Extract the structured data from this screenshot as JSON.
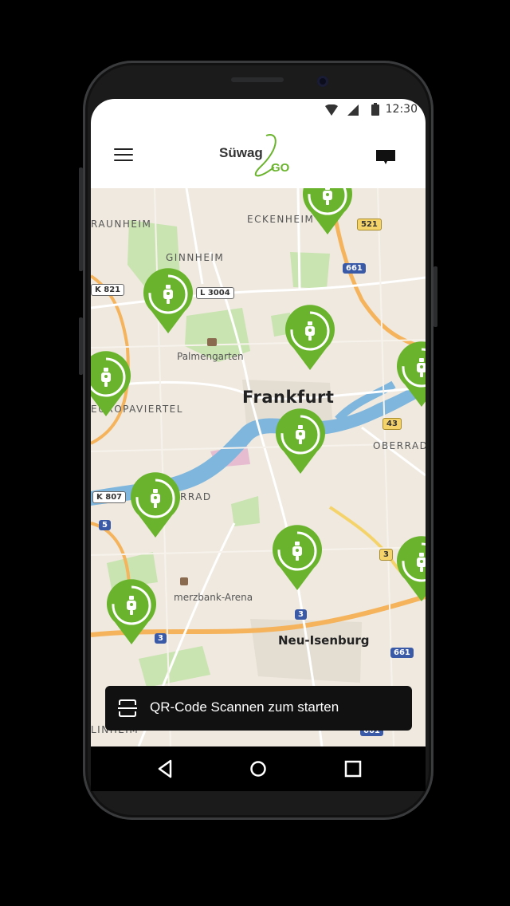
{
  "status": {
    "time": "12:30"
  },
  "header": {
    "logo_text": "Süwag",
    "logo_suffix": "GO",
    "menu_icon": "hamburger-menu-icon",
    "message_icon": "message-icon"
  },
  "map": {
    "labels": {
      "raunheim": "RAUNHEIM",
      "eckenheim": "ECKENHEIM",
      "ginnheim": "GINNHEIM",
      "palmengarten": "Palmengarten",
      "frankfurt": "Frankfurt",
      "europaviertel": "EUROPAVIERTEL",
      "oberrad": "OBERRAD",
      "rrad": "RRAD",
      "arena": "merzbank-Arena",
      "neu_isenburg": "Neu-Isenburg",
      "linheim": "LINHEIM"
    },
    "roads": {
      "r521": "521",
      "r661a": "661",
      "rk821": "K 821",
      "rl3004": "L 3004",
      "r43": "43",
      "rk807": "K 807",
      "r5": "5",
      "r3a": "3",
      "r3b": "3",
      "r3c": "3",
      "r661b": "661",
      "r661c": "661"
    },
    "colors": {
      "land": "#efe9df",
      "park": "#c9e4b0",
      "water": "#7fb6dd",
      "highway": "#f5b35c",
      "pin": "#6ab42d"
    }
  },
  "qr": {
    "label": "QR-Code Scannen zum starten",
    "icon": "qr-scan-icon"
  },
  "nav": {
    "back": "back-icon",
    "home": "home-icon",
    "recents": "recents-icon"
  }
}
